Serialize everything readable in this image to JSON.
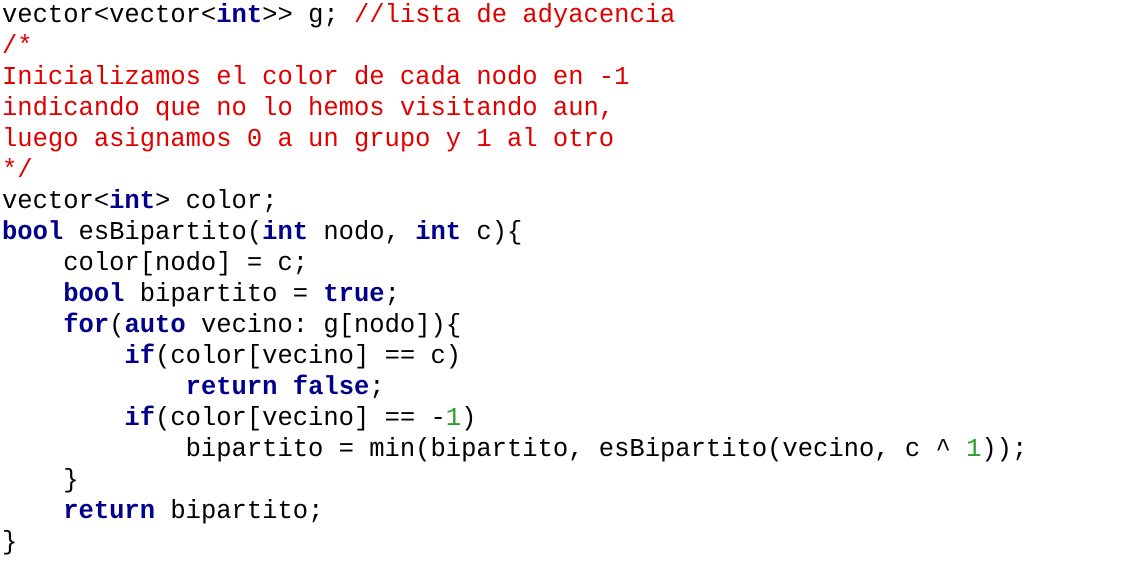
{
  "code": {
    "lines": [
      [
        {
          "t": "vector<vector<",
          "c": "id"
        },
        {
          "t": "int",
          "c": "kw"
        },
        {
          "t": ">> g; ",
          "c": "id"
        },
        {
          "t": "//lista de adyacencia",
          "c": "cm"
        }
      ],
      [
        {
          "t": "/*",
          "c": "cm"
        }
      ],
      [
        {
          "t": "Inicializamos el color de cada nodo en -1",
          "c": "cm"
        }
      ],
      [
        {
          "t": "indicando que no lo hemos visitando aun,",
          "c": "cm"
        }
      ],
      [
        {
          "t": "luego asignamos 0 a un grupo y 1 al otro",
          "c": "cm"
        }
      ],
      [
        {
          "t": "*/",
          "c": "cm"
        }
      ],
      [
        {
          "t": "vector<",
          "c": "id"
        },
        {
          "t": "int",
          "c": "kw"
        },
        {
          "t": "> color;",
          "c": "id"
        }
      ],
      [
        {
          "t": "bool",
          "c": "kw"
        },
        {
          "t": " esBipartito(",
          "c": "id"
        },
        {
          "t": "int",
          "c": "kw"
        },
        {
          "t": " nodo, ",
          "c": "id"
        },
        {
          "t": "int",
          "c": "kw"
        },
        {
          "t": " c){",
          "c": "id"
        }
      ],
      [
        {
          "t": "    color[nodo] = c;",
          "c": "id"
        }
      ],
      [
        {
          "t": "    ",
          "c": "id"
        },
        {
          "t": "bool",
          "c": "kw"
        },
        {
          "t": " bipartito = ",
          "c": "id"
        },
        {
          "t": "true",
          "c": "kw"
        },
        {
          "t": ";",
          "c": "id"
        }
      ],
      [
        {
          "t": "    ",
          "c": "id"
        },
        {
          "t": "for",
          "c": "kw"
        },
        {
          "t": "(",
          "c": "id"
        },
        {
          "t": "auto",
          "c": "kw"
        },
        {
          "t": " vecino: g[nodo]){",
          "c": "id"
        }
      ],
      [
        {
          "t": "        ",
          "c": "id"
        },
        {
          "t": "if",
          "c": "kw"
        },
        {
          "t": "(color[vecino] == c)",
          "c": "id"
        }
      ],
      [
        {
          "t": "            ",
          "c": "id"
        },
        {
          "t": "return",
          "c": "kw"
        },
        {
          "t": " ",
          "c": "id"
        },
        {
          "t": "false",
          "c": "kw"
        },
        {
          "t": ";",
          "c": "id"
        }
      ],
      [
        {
          "t": "        ",
          "c": "id"
        },
        {
          "t": "if",
          "c": "kw"
        },
        {
          "t": "(color[vecino] == -",
          "c": "id"
        },
        {
          "t": "1",
          "c": "num"
        },
        {
          "t": ")",
          "c": "id"
        }
      ],
      [
        {
          "t": "            bipartito = min(bipartito, esBipartito(vecino, c ^ ",
          "c": "id"
        },
        {
          "t": "1",
          "c": "num"
        },
        {
          "t": "));",
          "c": "id"
        }
      ],
      [
        {
          "t": "    }",
          "c": "id"
        }
      ],
      [
        {
          "t": "    ",
          "c": "id"
        },
        {
          "t": "return",
          "c": "kw"
        },
        {
          "t": " bipartito;",
          "c": "id"
        }
      ],
      [
        {
          "t": "}",
          "c": "id"
        }
      ]
    ]
  }
}
